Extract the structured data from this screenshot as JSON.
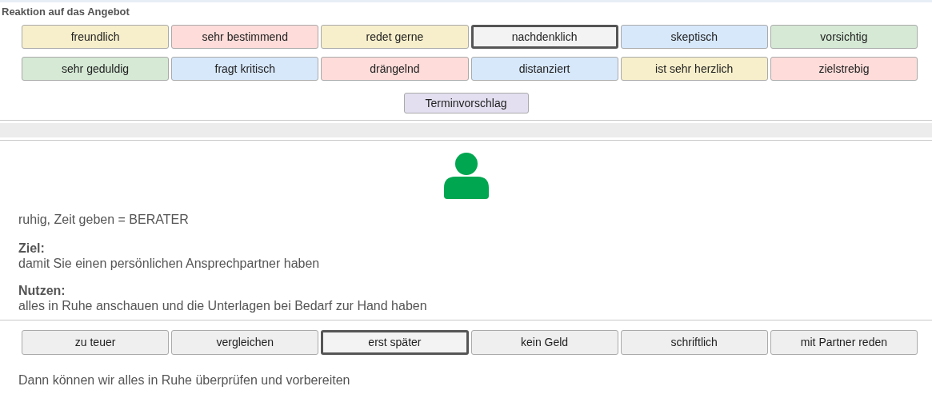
{
  "section_title": "Reaktion auf das Angebot",
  "reaction_buttons": [
    {
      "label": "freundlich",
      "color": "#f7efcb",
      "selected": false
    },
    {
      "label": "sehr bestimmend",
      "color": "#fddcd9",
      "selected": false
    },
    {
      "label": "redet gerne",
      "color": "#f7efcb",
      "selected": false
    },
    {
      "label": "nachdenklich",
      "color": "#f3f3f3",
      "selected": true
    },
    {
      "label": "skeptisch",
      "color": "#d7e8fb",
      "selected": false
    },
    {
      "label": "vorsichtig",
      "color": "#d5e9d5",
      "selected": false
    },
    {
      "label": "sehr geduldig",
      "color": "#d5e9d5",
      "selected": false
    },
    {
      "label": "fragt kritisch",
      "color": "#d7e8fb",
      "selected": false
    },
    {
      "label": "drängelnd",
      "color": "#fddcd9",
      "selected": false
    },
    {
      "label": "distanziert",
      "color": "#d7e8fb",
      "selected": false
    },
    {
      "label": "ist sehr herzlich",
      "color": "#f7efcb",
      "selected": false
    },
    {
      "label": "zielstrebig",
      "color": "#fddcd9",
      "selected": false
    }
  ],
  "appointment_button": {
    "label": "Terminvorschlag"
  },
  "advice": {
    "type_line": "ruhig, Zeit geben = BERATER",
    "goal_label": "Ziel:",
    "goal": "damit Sie einen persönlichen Ansprechpartner haben",
    "benefit_label": "Nutzen:",
    "benefit": "alles in Ruhe anschauen und die Unterlagen bei Bedarf zur Hand haben"
  },
  "objection_buttons": [
    {
      "label": "zu teuer",
      "selected": false
    },
    {
      "label": "vergleichen",
      "selected": false
    },
    {
      "label": "erst später",
      "selected": true
    },
    {
      "label": "kein Geld",
      "selected": false
    },
    {
      "label": "schriftlich",
      "selected": false
    },
    {
      "label": "mit Partner reden",
      "selected": false
    }
  ],
  "objection_answer": "Dann können wir alles in Ruhe überprüfen und vorbereiten"
}
